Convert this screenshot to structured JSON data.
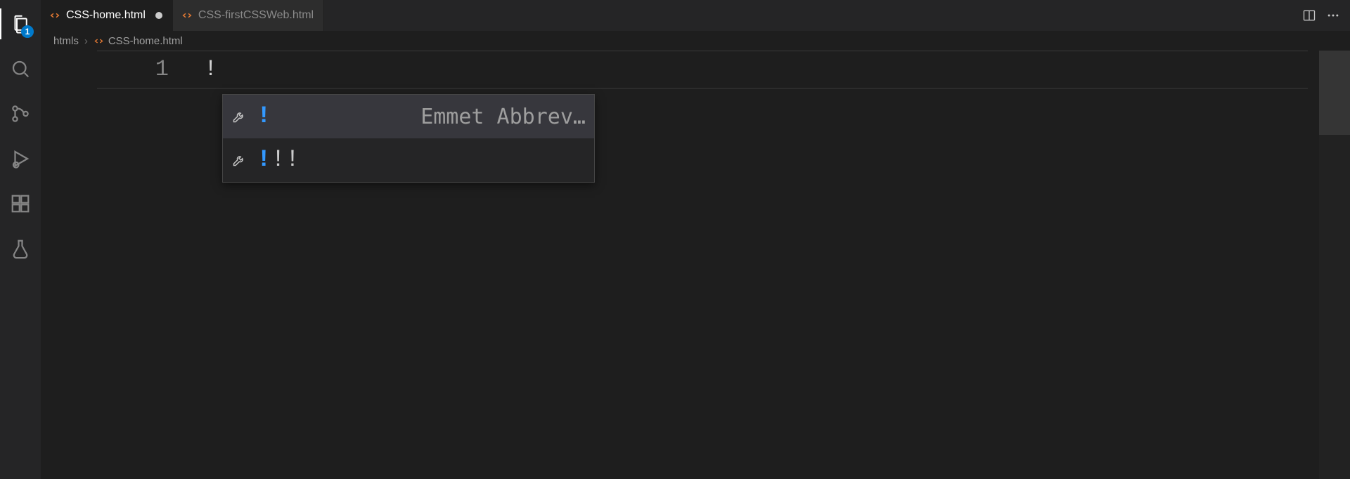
{
  "activityBar": {
    "explorerBadge": "1"
  },
  "tabs": [
    {
      "label": "CSS-home.html",
      "active": true,
      "dirty": true
    },
    {
      "label": "CSS-firstCSSWeb.html",
      "active": false,
      "dirty": false
    }
  ],
  "breadcrumb": {
    "folder": "htmls",
    "file": "CSS-home.html"
  },
  "editor": {
    "lineNumber": "1",
    "lineContent": "!"
  },
  "suggest": {
    "items": [
      {
        "label_hl": "!",
        "label_rest": "",
        "detail": "Emmet Abbrev…",
        "selected": true
      },
      {
        "label_hl": "!",
        "label_rest": "!!",
        "detail": "",
        "selected": false
      }
    ]
  }
}
